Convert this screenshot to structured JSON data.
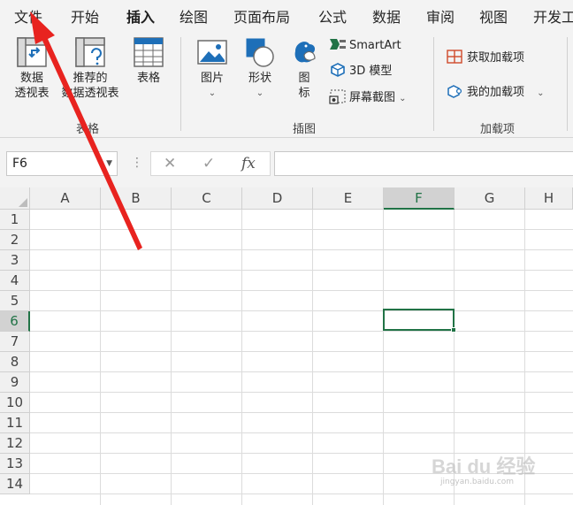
{
  "tabs": [
    {
      "label": "文件"
    },
    {
      "label": "开始"
    },
    {
      "label": "插入"
    },
    {
      "label": "绘图"
    },
    {
      "label": "页面布局"
    },
    {
      "label": "公式"
    },
    {
      "label": "数据"
    },
    {
      "label": "审阅"
    },
    {
      "label": "视图"
    },
    {
      "label": "开发工"
    }
  ],
  "active_tab": "插入",
  "ribbon": {
    "tables_group": {
      "label": "表格",
      "pivot_line1": "数据",
      "pivot_line2": "透视表",
      "recommended_line1": "推荐的",
      "recommended_line2": "数据透视表",
      "table": "表格"
    },
    "illustrations_group": {
      "label": "插图",
      "pictures": "图片",
      "shapes": "形状",
      "icons_line1": "图",
      "icons_line2": "标",
      "smartart": "SmartArt",
      "model3d": "3D 模型",
      "screenshot": "屏幕截图"
    },
    "addins_group": {
      "label": "加载项",
      "get_addins": "获取加载项",
      "my_addins": "我的加载项"
    }
  },
  "formula_bar": {
    "name_box": "F6",
    "cancel_symbol": "✕",
    "enter_symbol": "✓",
    "fx_symbol": "fx",
    "content": ""
  },
  "grid": {
    "columns": [
      "A",
      "B",
      "C",
      "D",
      "E",
      "F",
      "G",
      "H"
    ],
    "rows": [
      "1",
      "2",
      "3",
      "4",
      "5",
      "6",
      "7",
      "8",
      "9",
      "10",
      "11",
      "12",
      "13",
      "14"
    ],
    "selected_column": "F",
    "selected_row": "6"
  },
  "watermark": {
    "brand": "Bai du 经验",
    "url": "jingyan.baidu.com"
  },
  "colors": {
    "accent": "#217346",
    "annotation_arrow": "#e8231f"
  }
}
